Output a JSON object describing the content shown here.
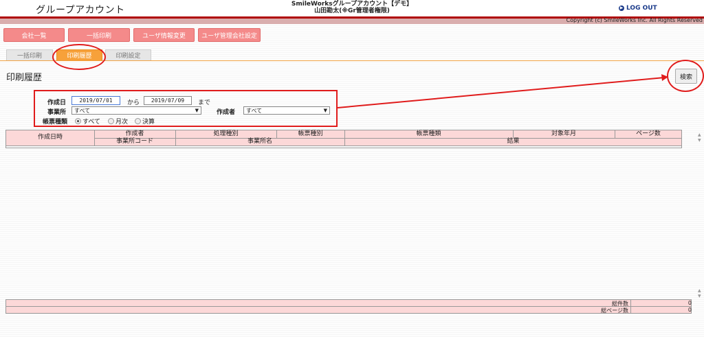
{
  "header": {
    "app_title": "グループアカウント",
    "company": "SmileWorksグループアカウント【デモ】",
    "user": "山田勘太(※Gr管理者権限)",
    "logout_label": "LOG OUT",
    "copyright": "Copyright (c) SmileWorks Inc. All Rights Reserved"
  },
  "nav": {
    "buttons": [
      "会社一覧",
      "一括印刷",
      "ユーザ情報変更",
      "ユーザ管理会社設定"
    ]
  },
  "tabs": [
    {
      "label": "一括印刷",
      "active": false
    },
    {
      "label": "印刷履歴",
      "active": true
    },
    {
      "label": "印刷設定",
      "active": false
    }
  ],
  "page": {
    "title": "印刷履歴",
    "search_label": "検索"
  },
  "form": {
    "date_label": "作成日",
    "date_from": "2019/07/01",
    "from_label": "から",
    "date_to": "2019/07/09",
    "to_label": "まで",
    "office_label": "事業所",
    "office_value": "すべて",
    "creator_label": "作成者",
    "creator_value": "すべて",
    "type_label": "帳票種類",
    "type_options": [
      {
        "label": "すべて",
        "checked": true
      },
      {
        "label": "月次",
        "checked": false
      },
      {
        "label": "決算",
        "checked": false
      }
    ]
  },
  "table": {
    "col_date": "作成日時",
    "row1": [
      "作成者",
      "処理種別",
      "帳票種別",
      "帳票種類",
      "対象年月",
      "ページ数"
    ],
    "row2": [
      "事業所コード",
      "事業所名",
      "結果"
    ]
  },
  "footer": {
    "total_count_label": "総件数",
    "total_count_value": "0",
    "total_pages_label": "総ページ数",
    "total_pages_value": "0"
  },
  "colors": {
    "accent_red": "#f48a8a",
    "tab_active": "#f7a13a",
    "header_bar": "#b00000",
    "table_header": "#fcd8d8",
    "annotation": "#e01b1b"
  }
}
